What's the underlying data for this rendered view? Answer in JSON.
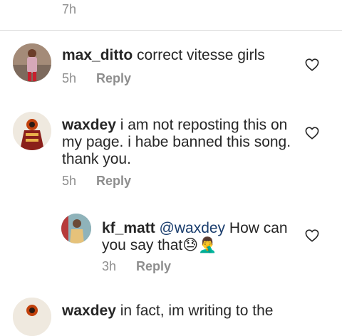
{
  "top_item": {
    "time": "7h"
  },
  "comments": [
    {
      "username": "max_ditto",
      "text": " correct vitesse girls",
      "time": "5h",
      "reply_label": "Reply",
      "like_icon": "heart-outline-icon"
    },
    {
      "username": "waxdey",
      "text_lines": [
        " i am not reposting this on",
        "my page. i habe banned this song.",
        "thank you."
      ],
      "time": "5h",
      "reply_label": "Reply",
      "like_icon": "heart-outline-icon"
    },
    {
      "username": "kf_matt",
      "mention": " @waxdey",
      "text_line1": " How can",
      "text_line2": "you say that😓🤦‍♂️",
      "time": "3h",
      "reply_label": "Reply",
      "like_icon": "heart-outline-icon"
    },
    {
      "username": "waxdey",
      "text": " in fact, im writing to the"
    }
  ],
  "colors": {
    "text": "#262626",
    "meta": "#8e8e8e",
    "mention": "#1a3d6d",
    "divider": "#dbdbdb"
  }
}
